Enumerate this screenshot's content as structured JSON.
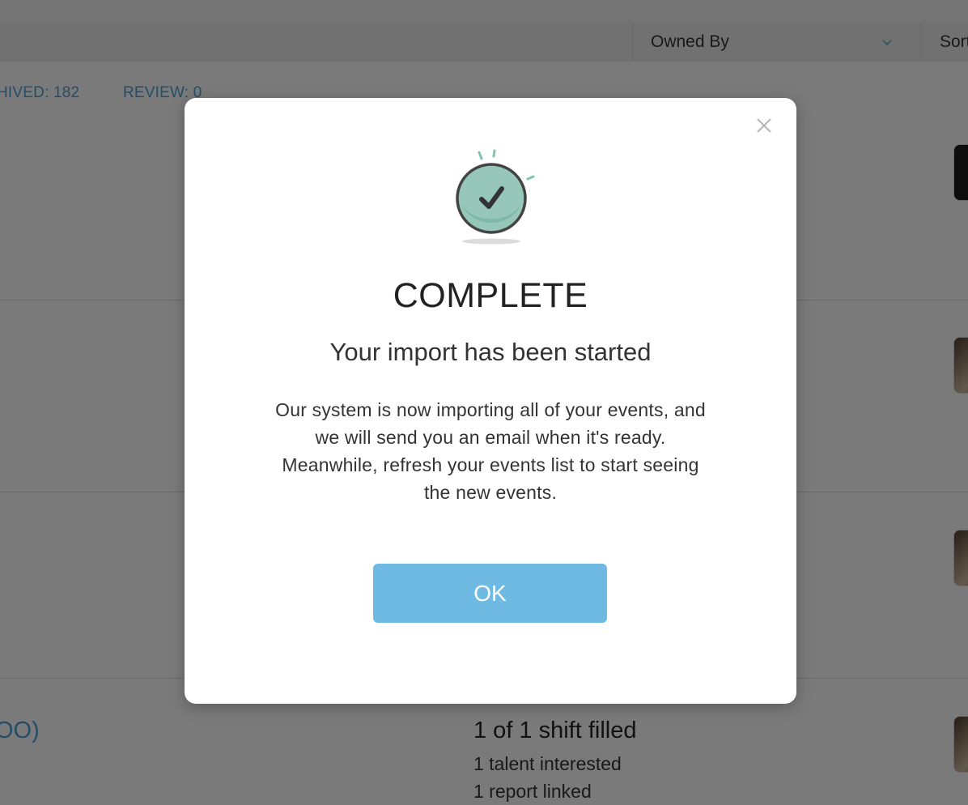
{
  "background": {
    "filters": {
      "owned_by": "Owned By",
      "sort": "Sort"
    },
    "counts": {
      "archived": "HIVED: 182",
      "review": "REVIEW: 0"
    },
    "event": {
      "title": "OO)",
      "shift_status": "1 of 1 shift filled",
      "talent": "1 talent interested",
      "report": "1 report linked"
    }
  },
  "modal": {
    "title": "COMPLETE",
    "subtitle": "Your import has been started",
    "body": "Our system is now importing all of your events, and we will send you an email when it's ready. Meanwhile, refresh your events list to start seeing the new events.",
    "ok_label": "OK",
    "icon": "check-circle-icon",
    "accent_color": "#6fbae3"
  }
}
